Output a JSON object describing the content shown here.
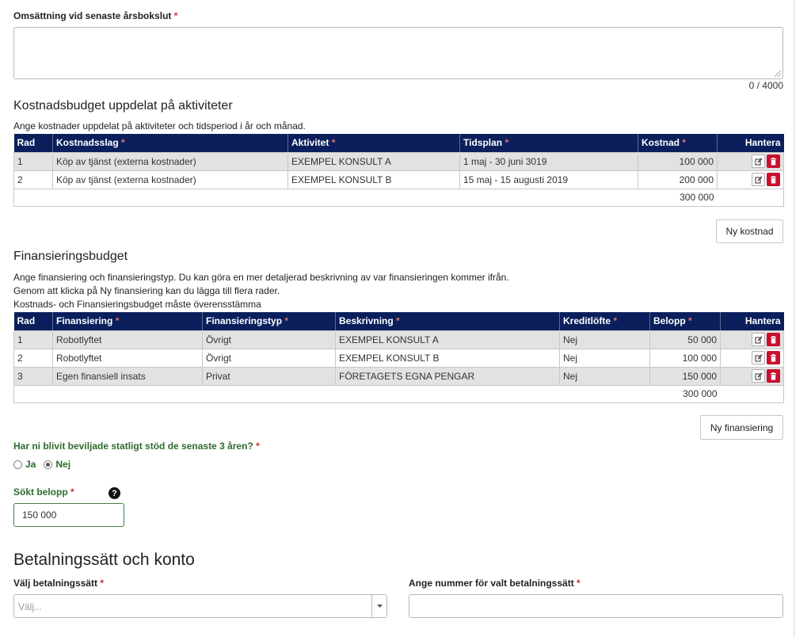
{
  "revenue": {
    "label": "Omsättning vid senaste årsbokslut",
    "required": "*",
    "value": "",
    "counter": "0 / 4000"
  },
  "cost_budget": {
    "title": "Kostnadsbudget uppdelat på aktiviteter",
    "description": "Ange kostnader uppdelat på aktiviteter och tidsperiod i år och månad.",
    "columns": [
      {
        "label": "Rad",
        "required": ""
      },
      {
        "label": "Kostnadsslag",
        "required": "*"
      },
      {
        "label": "Aktivitet",
        "required": "*"
      },
      {
        "label": "Tidsplan",
        "required": "*"
      },
      {
        "label": "Kostnad",
        "required": "*"
      },
      {
        "label": "Hantera",
        "required": ""
      }
    ],
    "rows": [
      {
        "rad": "1",
        "kostnadsslag": "Köp av tjänst (externa kostnader)",
        "aktivitet": "EXEMPEL KONSULT A",
        "tidsplan": "1 maj - 30 juni 3019",
        "kostnad": "100 000"
      },
      {
        "rad": "2",
        "kostnadsslag": "Köp av tjänst (externa kostnader)",
        "aktivitet": "EXEMPEL KONSULT B",
        "tidsplan": "15 maj - 15 augusti 2019",
        "kostnad": "200 000"
      }
    ],
    "total": "300 000",
    "add_button": "Ny kostnad"
  },
  "financing_budget": {
    "title": "Finansieringsbudget",
    "description_lines": [
      "Ange finansiering och finansieringstyp. Du kan göra en mer detaljerad beskrivning av var finansieringen kommer ifrån.",
      "Genom att klicka på Ny finansiering kan du lägga till flera rader.",
      "Kostnads- och Finansieringsbudget måste överensstämma"
    ],
    "columns": [
      {
        "label": "Rad",
        "required": ""
      },
      {
        "label": "Finansiering",
        "required": "*"
      },
      {
        "label": "Finansieringstyp",
        "required": "*"
      },
      {
        "label": "Beskrivning",
        "required": "*"
      },
      {
        "label": "Kreditlöfte",
        "required": "*"
      },
      {
        "label": "Belopp",
        "required": "*"
      },
      {
        "label": "Hantera",
        "required": ""
      }
    ],
    "rows": [
      {
        "rad": "1",
        "finansiering": "Robotlyftet",
        "typ": "Övrigt",
        "beskrivning": "EXEMPEL KONSULT A",
        "kreditlofte": "Nej",
        "belopp": "50 000"
      },
      {
        "rad": "2",
        "finansiering": "Robotlyftet",
        "typ": "Övrigt",
        "beskrivning": "EXEMPEL KONSULT B",
        "kreditlofte": "Nej",
        "belopp": "100 000"
      },
      {
        "rad": "3",
        "finansiering": "Egen finansiell insats",
        "typ": "Privat",
        "beskrivning": "FÖRETAGETS EGNA PENGAR",
        "kreditlofte": "Nej",
        "belopp": "150 000"
      }
    ],
    "total": "300 000",
    "add_button": "Ny finansiering"
  },
  "state_aid": {
    "question": "Har ni blivit beviljade statligt stöd de senaste 3 åren?",
    "required": "*",
    "options": [
      "Ja",
      "Nej"
    ],
    "selected": "Nej"
  },
  "amount": {
    "label": "Sökt belopp",
    "required": "*",
    "value": "150 000",
    "help_icon": "question-circle-icon"
  },
  "payment": {
    "title": "Betalningssätt och konto",
    "method_label": "Välj betalningssätt",
    "method_required": "*",
    "method_placeholder": "Välj...",
    "number_label": "Ange nummer för valt betalningssätt",
    "number_required": "*",
    "number_value": ""
  },
  "colors": {
    "table_header": "#0b1f5c",
    "delete_button": "#c8102e",
    "required_star": "#c9302c",
    "green_label": "#2e6b2e"
  }
}
